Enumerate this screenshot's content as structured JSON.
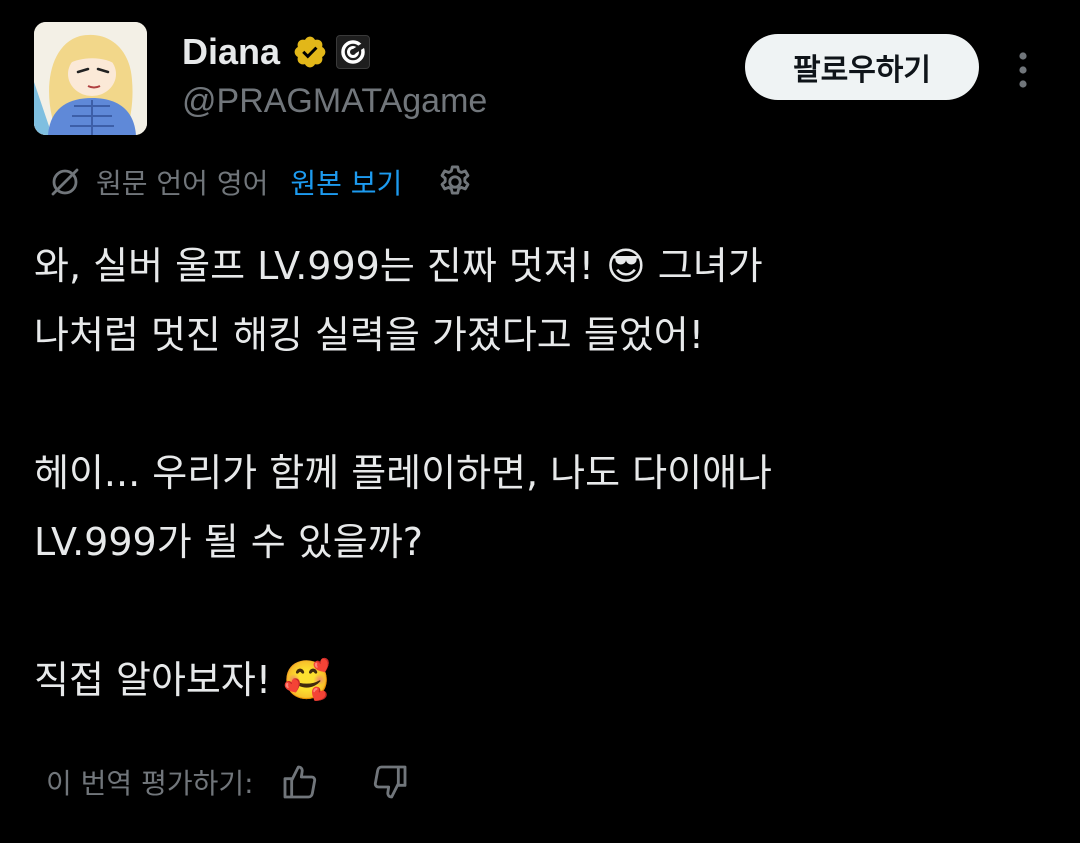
{
  "author": {
    "display_name": "Diana",
    "handle": "@PRAGMATAgame",
    "avatar_icon": "anime-girl-avatar",
    "verified_icon": "gold-verified-badge-icon",
    "affiliate_icon": "pragmata-affiliate-badge-icon"
  },
  "actions": {
    "follow_label": "팔로우하기",
    "more_icon": "more-vertical-icon"
  },
  "translation": {
    "original_language": "원문 언어 영어",
    "show_original": "원본 보기",
    "settings_icon": "gear-icon",
    "rate_label": "이 번역 평가하기:",
    "thumbs_up_icon": "thumbs-up-icon",
    "thumbs_down_icon": "thumbs-down-icon"
  },
  "tweet": {
    "text": "와, 실버 울프 LV.999는 진짜 멋져! 😎 그녀가\n나처럼 멋진 해킹 실력을 가졌다고 들었어!\n\n헤이... 우리가 함께 플레이하면, 나도 다이애나\nLV.999가 될 수 있을까?\n\n직접 알아보자! 🥰"
  },
  "colors": {
    "background": "#000000",
    "text_primary": "#e7e9ea",
    "text_secondary": "#71767b",
    "link": "#1d9bf0",
    "verified_gold": "#e2b719",
    "follow_button_bg": "#eff3f4"
  }
}
